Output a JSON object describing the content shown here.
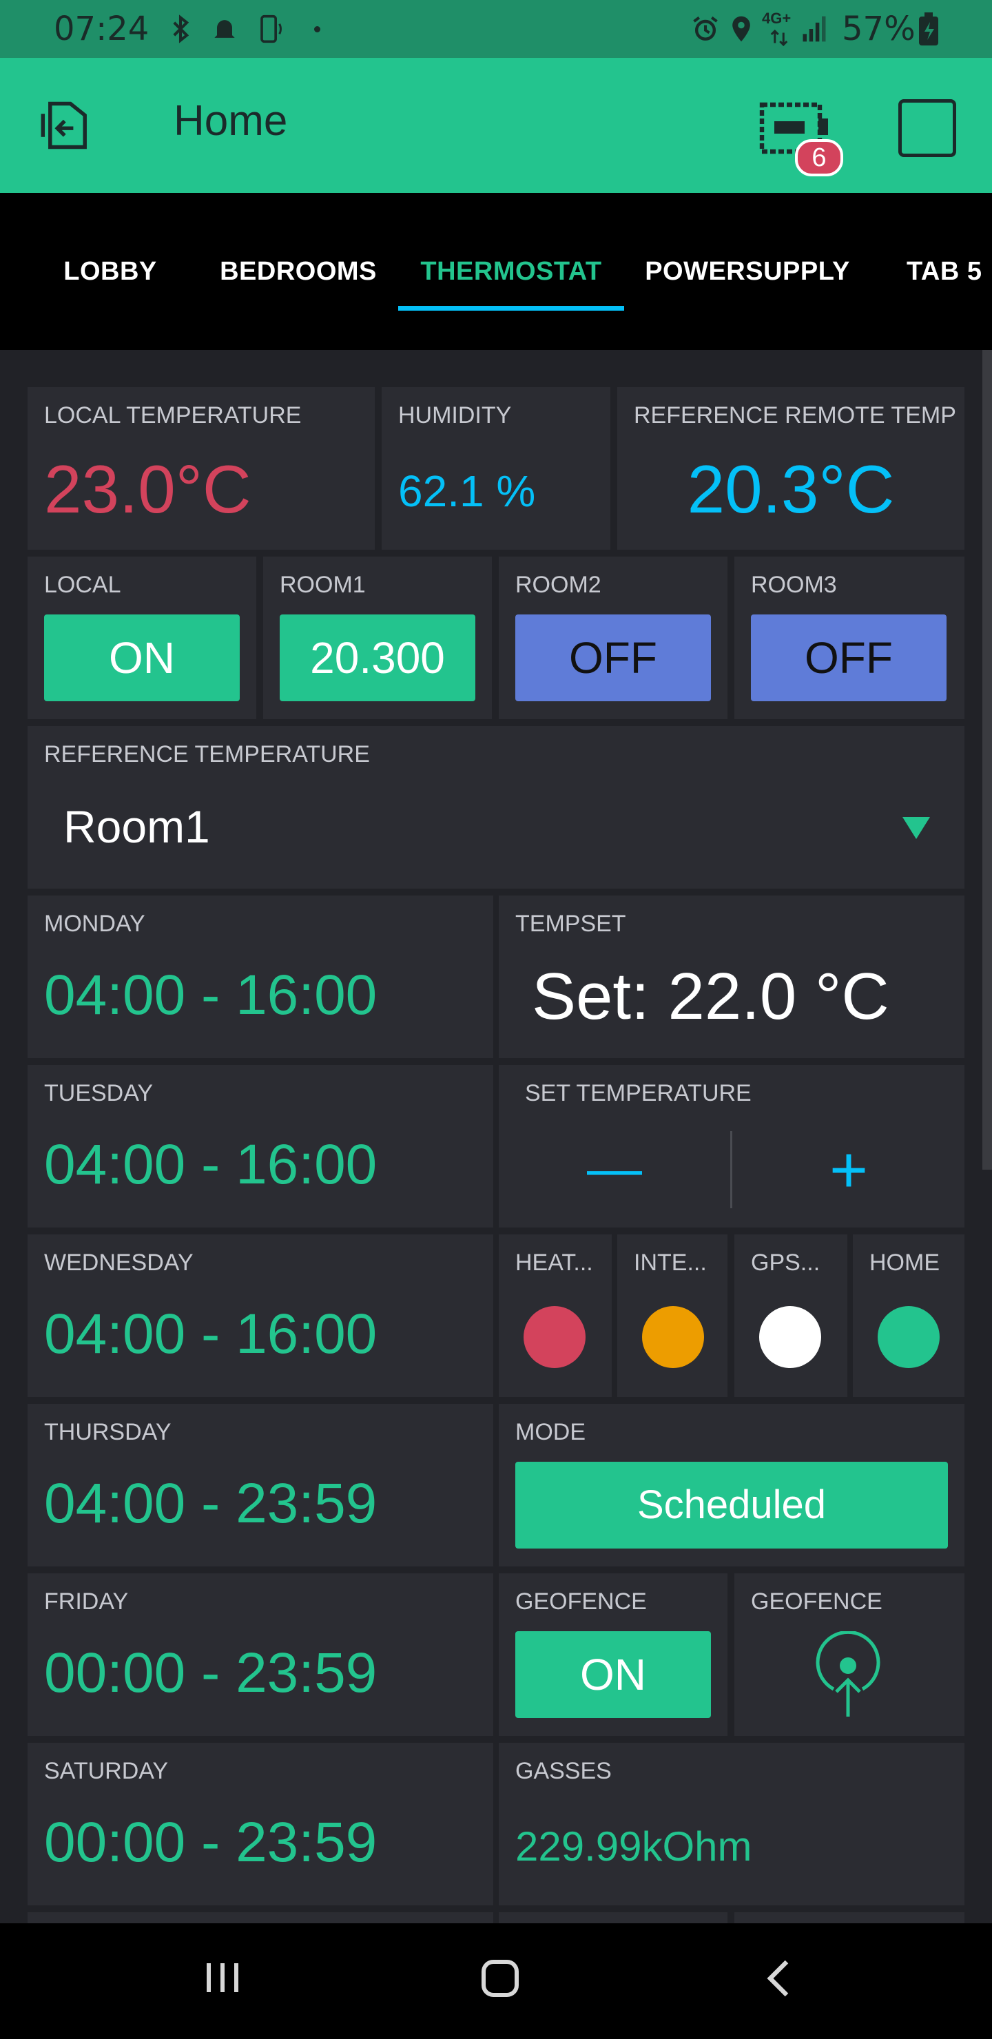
{
  "statusbar": {
    "time": "07:24",
    "network": "4G+",
    "battery": "57%"
  },
  "appbar": {
    "title": "Home",
    "device_badge": "6"
  },
  "tabs": [
    {
      "label": "LOBBY"
    },
    {
      "label": "BEDROOMS"
    },
    {
      "label": "THERMOSTAT"
    },
    {
      "label": "POWERSUPPLY"
    },
    {
      "label": "TAB 5"
    }
  ],
  "widgets": {
    "local_temp": {
      "label": "LOCAL TEMPERATURE",
      "value": "23.0°C",
      "color": "#d3435c"
    },
    "humidity": {
      "label": "HUMIDITY",
      "value": "62.1 %",
      "color": "#04c0f8"
    },
    "remote_temp": {
      "label": "REFERENCE REMOTE TEMP",
      "value": "20.3°C",
      "color": "#04c0f8"
    },
    "local_btn": {
      "label": "LOCAL",
      "value": "ON"
    },
    "room1_btn": {
      "label": "ROOM1",
      "value": "20.300"
    },
    "room2_btn": {
      "label": "ROOM2",
      "value": "OFF"
    },
    "room3_btn": {
      "label": "ROOM3",
      "value": "OFF"
    },
    "ref_temp": {
      "label": "REFERENCE TEMPERATURE",
      "selected": "Room1"
    },
    "monday": {
      "label": "MONDAY",
      "value": "04:00 - 16:00"
    },
    "tempset": {
      "label": "TEMPSET",
      "value": "Set: 22.0 °C"
    },
    "tuesday": {
      "label": "TUESDAY",
      "value": "04:00 - 16:00"
    },
    "set_temp": {
      "label": "SET TEMPERATURE",
      "minus": "—",
      "plus": "+"
    },
    "wednesday": {
      "label": "WEDNESDAY",
      "value": "04:00 - 16:00"
    },
    "leds": [
      {
        "label": "HEAT...",
        "color": "#d3435c"
      },
      {
        "label": "INTE...",
        "color": "#ed9d00"
      },
      {
        "label": "GPS...",
        "color": "#ffffff"
      },
      {
        "label": "HOME",
        "color": "#23c48e"
      }
    ],
    "thursday": {
      "label": "THURSDAY",
      "value": "04:00 - 23:59"
    },
    "mode": {
      "label": "MODE",
      "value": "Scheduled"
    },
    "friday": {
      "label": "FRIDAY",
      "value": "00:00 - 23:59"
    },
    "geofence_btn": {
      "label": "GEOFENCE",
      "value": "ON"
    },
    "geofence_trigger": {
      "label": "GEOFENCE"
    },
    "saturday": {
      "label": "SATURDAY",
      "value": "00:00 - 23:59"
    },
    "gasses": {
      "label": "GASSES",
      "value": "229.99kOhm"
    }
  },
  "colors": {
    "accent": "#23c48e",
    "panel": "#2b2c32",
    "background": "#212227",
    "blue": "#04c0f8",
    "button_blue": "#5f7cd8"
  }
}
